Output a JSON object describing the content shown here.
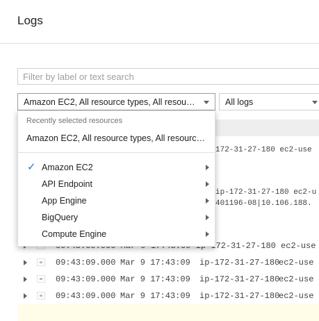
{
  "header": {
    "title": "Logs"
  },
  "filter": {
    "placeholder": "Filter by label or text search"
  },
  "resource_select": {
    "value": "Amazon EC2, All resource types, All resourc…"
  },
  "logs_select": {
    "value": "All logs"
  },
  "dropdown": {
    "section_label": "Recently selected resources",
    "recent": "Amazon EC2, All resource types, All resource l…",
    "items": [
      {
        "label": "Amazon EC2",
        "checked": true
      },
      {
        "label": "API Endpoint",
        "checked": false
      },
      {
        "label": "App Engine",
        "checked": false
      },
      {
        "label": "BigQuery",
        "checked": false
      },
      {
        "label": "Compute Engine",
        "checked": false
      }
    ]
  },
  "fragments": {
    "r1": "172-31-27-180 ec2-use",
    "r2a": "ip-172-31-27-180 ec2-u",
    "r2b": "401196-08|10.106.188.",
    "r3": "09:43:09.000 Mar 9 17:43:09 ip-172-31-27-180 ec2-use"
  },
  "log_rows": [
    {
      "time": "09:43:09.000",
      "date": "Mar 9 17:43:09",
      "host": "ip-172-31-27-180",
      "service": "ec2-use"
    },
    {
      "time": "09:43:09.000",
      "date": "Mar 9 17:43:09",
      "host": "ip-172-31-27-180",
      "service": "ec2-use"
    },
    {
      "time": "09:43:09.000",
      "date": "Mar 9 17:43:09",
      "host": "ip-172-31-27-180",
      "service": "ec2-use"
    }
  ],
  "icons": {
    "arrow": "chevron-right-icon",
    "caret": "caret-down-icon",
    "check": "check-icon"
  },
  "colors": {
    "check": "#1a73e8",
    "highlight_row": "#fffde7"
  }
}
